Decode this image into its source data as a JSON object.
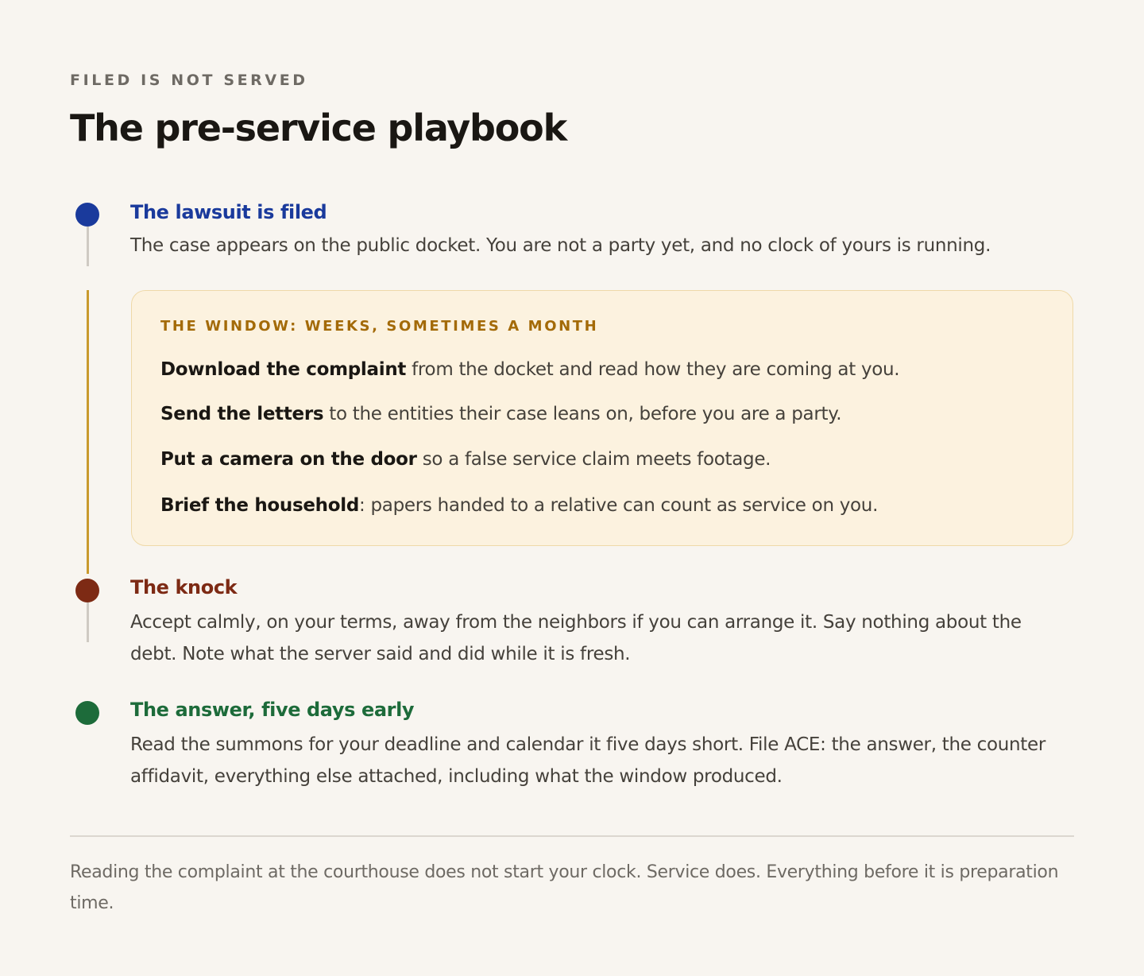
{
  "header": {
    "eyebrow": "FILED IS NOT SERVED",
    "title": "The pre-service playbook"
  },
  "colors": {
    "filed": "#1a3a9c",
    "window": "#c99a2e",
    "knock": "#7d2a14",
    "answer": "#1d6b3a",
    "connector": "#cfcac3"
  },
  "steps": {
    "filed": {
      "title": "The lawsuit is filed",
      "body": "The case appears on the public docket. You are not a party yet, and no clock of yours is running."
    },
    "window": {
      "title": "THE WINDOW: WEEKS, SOMETIMES A MONTH",
      "items": [
        {
          "bold": "Download the complaint",
          "rest": " from the docket and read how they are coming at you."
        },
        {
          "bold": "Send the letters",
          "rest": " to the entities their case leans on, before you are a party."
        },
        {
          "bold": "Put a camera on the door",
          "rest": " so a false service claim meets footage."
        },
        {
          "bold": "Brief the household",
          "rest": ": papers handed to a relative can count as service on you."
        }
      ]
    },
    "knock": {
      "title": "The knock",
      "body": "Accept calmly, on your terms, away from the neighbors if you can arrange it. Say nothing about the debt. Note what the server said and did while it is fresh."
    },
    "answer": {
      "title": "The answer, five days early",
      "body": "Read the summons for your deadline and calendar it five days short. File ACE: the answer, the counter affidavit, everything else attached, including what the window produced."
    }
  },
  "footer": {
    "note": "Reading the complaint at the courthouse does not start your clock. Service does. Everything before it is preparation time."
  }
}
